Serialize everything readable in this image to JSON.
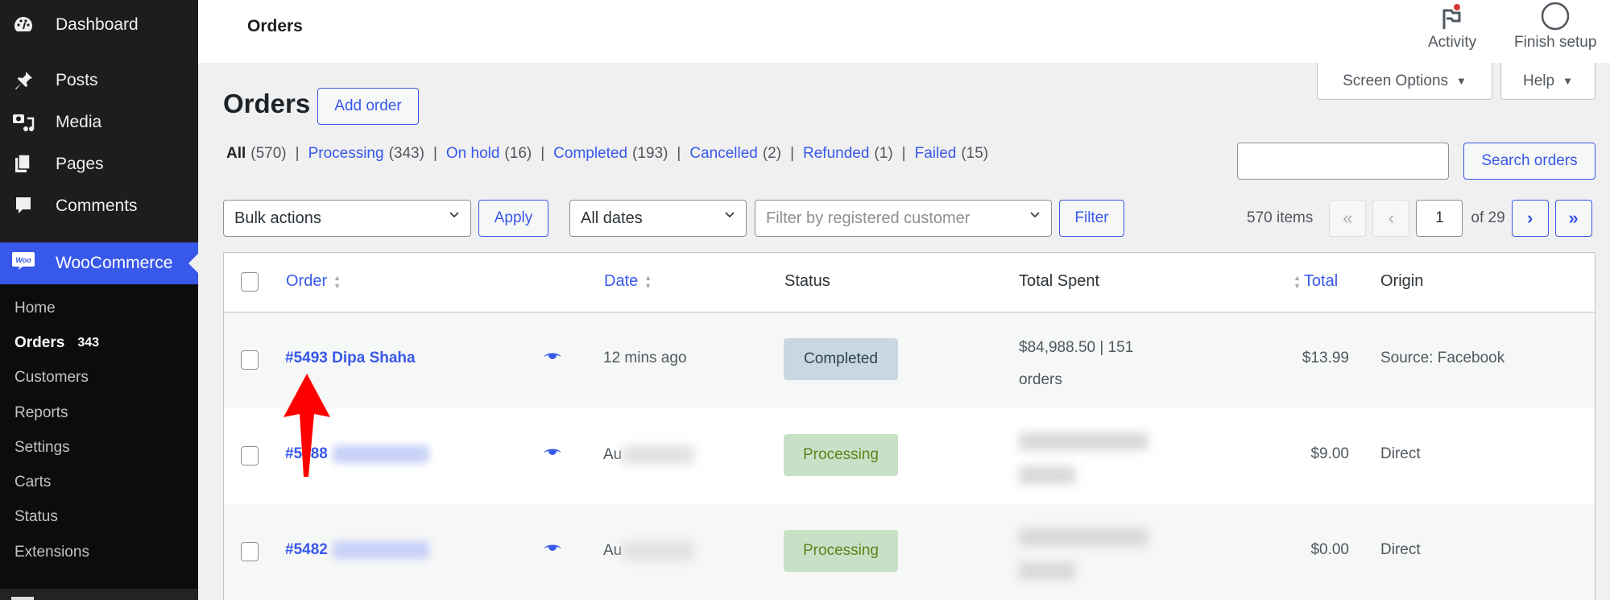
{
  "sidebar": {
    "items": [
      {
        "label": "Dashboard",
        "icon": "dashboard-icon"
      },
      {
        "label": "Posts",
        "icon": "pin-icon"
      },
      {
        "label": "Media",
        "icon": "media-icon"
      },
      {
        "label": "Pages",
        "icon": "pages-icon"
      },
      {
        "label": "Comments",
        "icon": "comment-icon"
      }
    ],
    "woocommerce": {
      "label": "WooCommerce",
      "icon_text": "Woo"
    },
    "submenu": [
      {
        "label": "Home"
      },
      {
        "label": "Orders",
        "count": "343",
        "active": true
      },
      {
        "label": "Customers"
      },
      {
        "label": "Reports"
      },
      {
        "label": "Settings"
      },
      {
        "label": "Carts"
      },
      {
        "label": "Status"
      },
      {
        "label": "Extensions"
      }
    ]
  },
  "header": {
    "title": "Orders",
    "activity_label": "Activity",
    "finish_setup_label": "Finish setup",
    "screen_options_label": "Screen Options",
    "help_label": "Help"
  },
  "page": {
    "heading": "Orders",
    "add_order_label": "Add order",
    "filters": [
      {
        "label": "All",
        "count": "(570)",
        "current": true
      },
      {
        "label": "Processing",
        "count": "(343)"
      },
      {
        "label": "On hold",
        "count": "(16)"
      },
      {
        "label": "Completed",
        "count": "(193)"
      },
      {
        "label": "Cancelled",
        "count": "(2)"
      },
      {
        "label": "Refunded",
        "count": "(1)"
      },
      {
        "label": "Failed",
        "count": "(15)"
      }
    ],
    "search": {
      "value": "",
      "button_label": "Search orders"
    },
    "bulk_actions": {
      "selected": "Bulk actions",
      "apply_label": "Apply"
    },
    "date_filter": {
      "selected": "All dates"
    },
    "customer_filter": {
      "placeholder": "Filter by registered customer",
      "filter_label": "Filter"
    },
    "pagination": {
      "items_label": "570 items",
      "first": "«",
      "prev": "‹",
      "next": "›",
      "last": "»",
      "current_page": "1",
      "of_label": "of 29"
    }
  },
  "table": {
    "columns": {
      "order": "Order",
      "date": "Date",
      "status": "Status",
      "total_spent": "Total Spent",
      "total": "Total",
      "origin": "Origin"
    },
    "rows": [
      {
        "order": "#5493 Dipa Shaha",
        "date": "12 mins ago",
        "status": "Completed",
        "total_spent": "$84,988.50 | 151 orders",
        "total": "$13.99",
        "origin": "Source: Facebook",
        "blurred": false
      },
      {
        "order": "#5488",
        "date": "Au",
        "status": "Processing",
        "total_spent": "",
        "total": "$9.00",
        "origin": "Direct",
        "blurred": true
      },
      {
        "order": "#5482",
        "date": "Au",
        "status": "Processing",
        "total_spent": "",
        "total": "$0.00",
        "origin": "Direct",
        "blurred": true
      }
    ]
  },
  "colors": {
    "accent": "#3858e9",
    "sidebar_bg": "#1d1d1d",
    "completed_badge": "#c8d7e1",
    "processing_badge": "#c6e1c6",
    "annotation_arrow": "#ff0000"
  }
}
